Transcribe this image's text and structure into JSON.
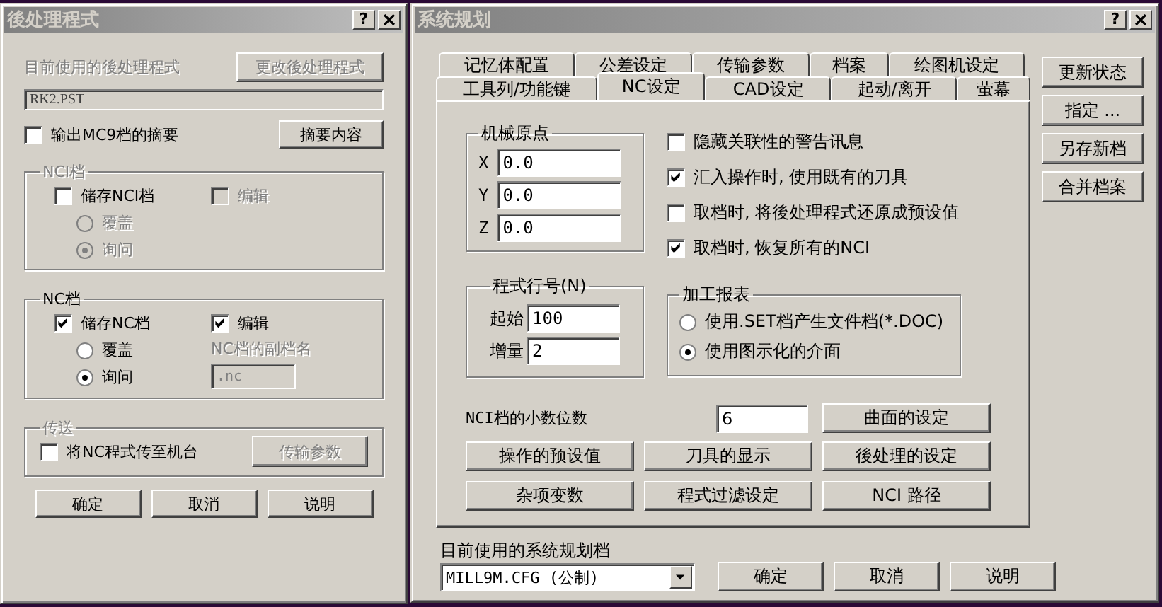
{
  "left_window": {
    "title": "後处理程式",
    "help": "?",
    "current_label": {
      "text": "目前使用的後处理程式",
      "disabled": true
    },
    "change_button": {
      "label": "更改後处理程式",
      "disabled": true
    },
    "current_value": {
      "value": "RK2.PST",
      "disabled": true
    },
    "summary_checkbox": {
      "label": "输出MC9档的摘要",
      "checked": false
    },
    "summary_button": {
      "label": "摘要内容"
    },
    "groups": [
      {
        "title": "NCI档",
        "disabled": true,
        "left": [
          {
            "kind": "checkbox",
            "label": "储存NCI档",
            "checked": false
          },
          {
            "kind": "radio",
            "label": "覆盖",
            "selected": false,
            "disabled": true
          },
          {
            "kind": "radio",
            "label": "询问",
            "selected": true,
            "disabled": true
          }
        ],
        "right": [
          {
            "kind": "checkbox",
            "label": "编辑",
            "checked": false,
            "disabled": true
          }
        ]
      },
      {
        "title": "NC档",
        "disabled": false,
        "left": [
          {
            "kind": "checkbox",
            "label": "储存NC档",
            "checked": true
          },
          {
            "kind": "radio",
            "label": "覆盖",
            "selected": false
          },
          {
            "kind": "radio",
            "label": "询问",
            "selected": true
          }
        ],
        "right": [
          {
            "kind": "checkbox",
            "label": "编辑",
            "checked": true
          },
          {
            "kind": "label",
            "label": "NC档的副档名",
            "disabled": true
          },
          {
            "kind": "field",
            "value": ".nc",
            "disabled": true
          }
        ]
      },
      {
        "title": "传送",
        "disabled": true,
        "left": [
          {
            "kind": "checkbox",
            "label": "将NC程式传至机台",
            "checked": false
          }
        ],
        "right": [
          {
            "kind": "button",
            "label": "传输参数",
            "disabled": true
          }
        ]
      }
    ],
    "buttons": [
      "确定",
      "取消",
      "说明"
    ]
  },
  "right_window": {
    "title": "系统规划",
    "help": "?",
    "tab_rows": [
      {
        "tabs": [
          {
            "label": "记忆体配置",
            "selected": false
          },
          {
            "label": "公差设定",
            "selected": false
          },
          {
            "label": "传输参数",
            "selected": false
          },
          {
            "label": "档案",
            "selected": false
          },
          {
            "label": "绘图机设定",
            "selected": false
          }
        ]
      },
      {
        "tabs": [
          {
            "label": "工具列/功能键",
            "selected": false
          },
          {
            "label": "NC设定",
            "selected": true
          },
          {
            "label": "CAD设定",
            "selected": false
          },
          {
            "label": "起动/离开",
            "selected": false
          },
          {
            "label": "萤幕",
            "selected": false
          }
        ]
      }
    ],
    "side_buttons": [
      "更新状态",
      "指定 ...",
      "另存新档",
      "合并档案"
    ],
    "origin_group": {
      "title": "机械原点",
      "fields": [
        {
          "axis": "X",
          "value": "0.0"
        },
        {
          "axis": "Y",
          "value": "0.0"
        },
        {
          "axis": "Z",
          "value": "0.0"
        }
      ]
    },
    "options": [
      {
        "label": "隐藏关联性的警告讯息",
        "checked": false
      },
      {
        "label": "汇入操作时, 使用既有的刀具",
        "checked": true
      },
      {
        "label": "取档时, 将後处理程式还原成预设值",
        "checked": false
      },
      {
        "label": "取档时, 恢复所有的NCI",
        "checked": true
      }
    ],
    "line_number_group": {
      "title": "程式行号(N)",
      "fields": [
        {
          "label": "起始",
          "value": "100"
        },
        {
          "label": "增量",
          "value": "2"
        }
      ]
    },
    "report_group": {
      "title": "加工报表",
      "options": [
        {
          "label": "使用.SET档产生文件档(*.DOC)",
          "selected": false
        },
        {
          "label": "使用图示化的介面",
          "selected": true
        }
      ]
    },
    "nci_decimals": {
      "label": "NCI档的小数位数",
      "value": "6"
    },
    "surface_button": "曲面的设定",
    "settings_buttons": [
      "操作的预设值",
      "刀具的显示",
      "後处理的设定",
      "杂项变数",
      "程式过滤设定",
      "NCI 路径"
    ],
    "config": {
      "label": "目前使用的系统规划档",
      "value": "MILL9M.CFG (公制)"
    },
    "buttons": [
      "确定",
      "取消",
      "说明"
    ]
  }
}
